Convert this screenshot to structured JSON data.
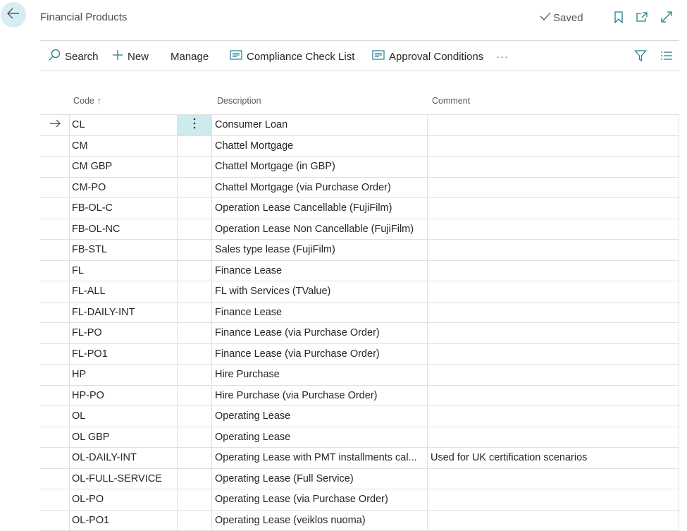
{
  "header": {
    "title": "Financial Products",
    "saved_label": "Saved",
    "icons": [
      "back-arrow-icon",
      "bookmark-icon",
      "open-new-window-icon",
      "expand-icon"
    ]
  },
  "actions": {
    "search": "Search",
    "new": "New",
    "manage": "Manage",
    "compliance": "Compliance Check List",
    "approval": "Approval Conditions",
    "more": "···"
  },
  "columns": {
    "code": "Code ↑",
    "description": "Description",
    "comment": "Comment"
  },
  "colors": {
    "accent": "#d6eef1",
    "icon_teal": "#1f7f8c",
    "selected_menu": "#cdebee"
  },
  "rows": [
    {
      "code": "CL",
      "description": "Consumer Loan",
      "comment": ""
    },
    {
      "code": "CM",
      "description": "Chattel Mortgage",
      "comment": ""
    },
    {
      "code": "CM GBP",
      "description": "Chattel Mortgage (in GBP)",
      "comment": ""
    },
    {
      "code": "CM-PO",
      "description": "Chattel Mortgage (via Purchase Order)",
      "comment": ""
    },
    {
      "code": "FB-OL-C",
      "description": "Operation Lease Cancellable (FujiFilm)",
      "comment": ""
    },
    {
      "code": "FB-OL-NC",
      "description": "Operation Lease Non Cancellable (FujiFilm)",
      "comment": ""
    },
    {
      "code": "FB-STL",
      "description": "Sales type lease (FujiFilm)",
      "comment": ""
    },
    {
      "code": "FL",
      "description": "Finance Lease",
      "comment": ""
    },
    {
      "code": "FL-ALL",
      "description": "FL with Services (TValue)",
      "comment": ""
    },
    {
      "code": "FL-DAILY-INT",
      "description": "Finance Lease",
      "comment": ""
    },
    {
      "code": "FL-PO",
      "description": "Finance Lease (via Purchase Order)",
      "comment": ""
    },
    {
      "code": "FL-PO1",
      "description": "Finance Lease (via Purchase Order)",
      "comment": ""
    },
    {
      "code": "HP",
      "description": "Hire Purchase",
      "comment": ""
    },
    {
      "code": "HP-PO",
      "description": "Hire Purchase (via Purchase Order)",
      "comment": ""
    },
    {
      "code": "OL",
      "description": "Operating Lease",
      "comment": ""
    },
    {
      "code": "OL GBP",
      "description": "Operating Lease",
      "comment": ""
    },
    {
      "code": "OL-DAILY-INT",
      "description": "Operating Lease with PMT installments cal...",
      "comment": "Used for UK certification scenarios"
    },
    {
      "code": "OL-FULL-SERVICE",
      "description": "Operating Lease (Full Service)",
      "comment": ""
    },
    {
      "code": "OL-PO",
      "description": "Operating Lease (via Purchase Order)",
      "comment": ""
    },
    {
      "code": "OL-PO1",
      "description": "Operating Lease (veiklos nuoma)",
      "comment": ""
    }
  ]
}
